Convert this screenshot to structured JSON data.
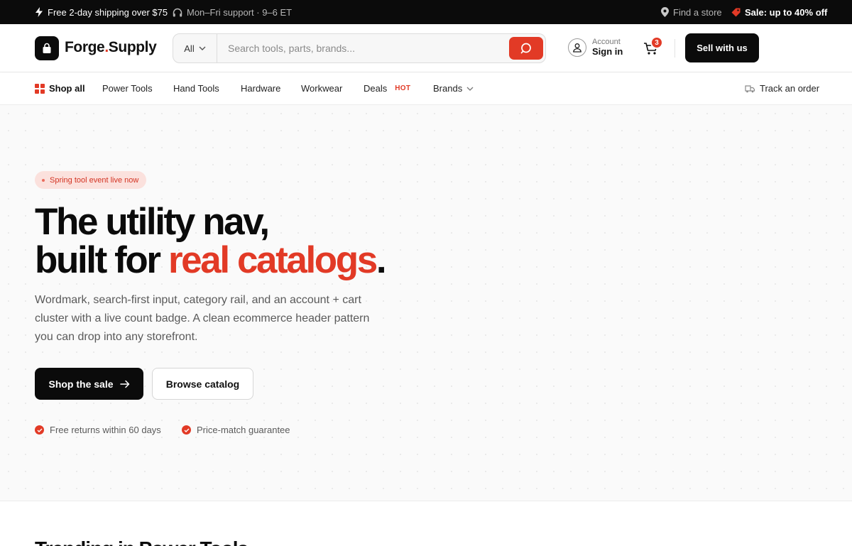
{
  "topbar": {
    "shipping": "Free 2-day shipping over $75",
    "support": "Mon–Fri support · 9–6 ET",
    "find_store": "Find a store",
    "sale": "Sale: up to 40% off"
  },
  "header": {
    "brand_name": "Forge",
    "brand_dot": ".",
    "brand_suffix": "Supply",
    "search": {
      "category": "All",
      "placeholder": "Search tools, parts, brands..."
    },
    "account": {
      "label": "Account",
      "action": "Sign in"
    },
    "cart_count": "3",
    "sell_label": "Sell with us"
  },
  "nav": {
    "shop_all": "Shop all",
    "items": [
      "Power Tools",
      "Hand Tools",
      "Hardware",
      "Workwear",
      "Deals",
      "Brands"
    ],
    "deals_tag": "HOT",
    "track_order": "Track an order"
  },
  "hero": {
    "pill": "Spring tool event live now",
    "headline_line1": "The utility nav,",
    "headline_line2_plain": "built for ",
    "headline_line2_accent": "real catalogs",
    "headline_period": ".",
    "subtext": "Wordmark, search-first input, category rail, and an account + cart cluster with a live count badge. A clean ecommerce header pattern you can drop into any storefront.",
    "primary_cta": "Shop the sale",
    "secondary_cta": "Browse catalog",
    "perks": [
      "Free returns within 60 days",
      "Price-match guarantee"
    ]
  },
  "next_section": {
    "title": "Trending in Power Tools"
  },
  "colors": {
    "accent": "#e23a26",
    "ink": "#0b0b0b",
    "pill_bg": "#fbe1dd"
  }
}
